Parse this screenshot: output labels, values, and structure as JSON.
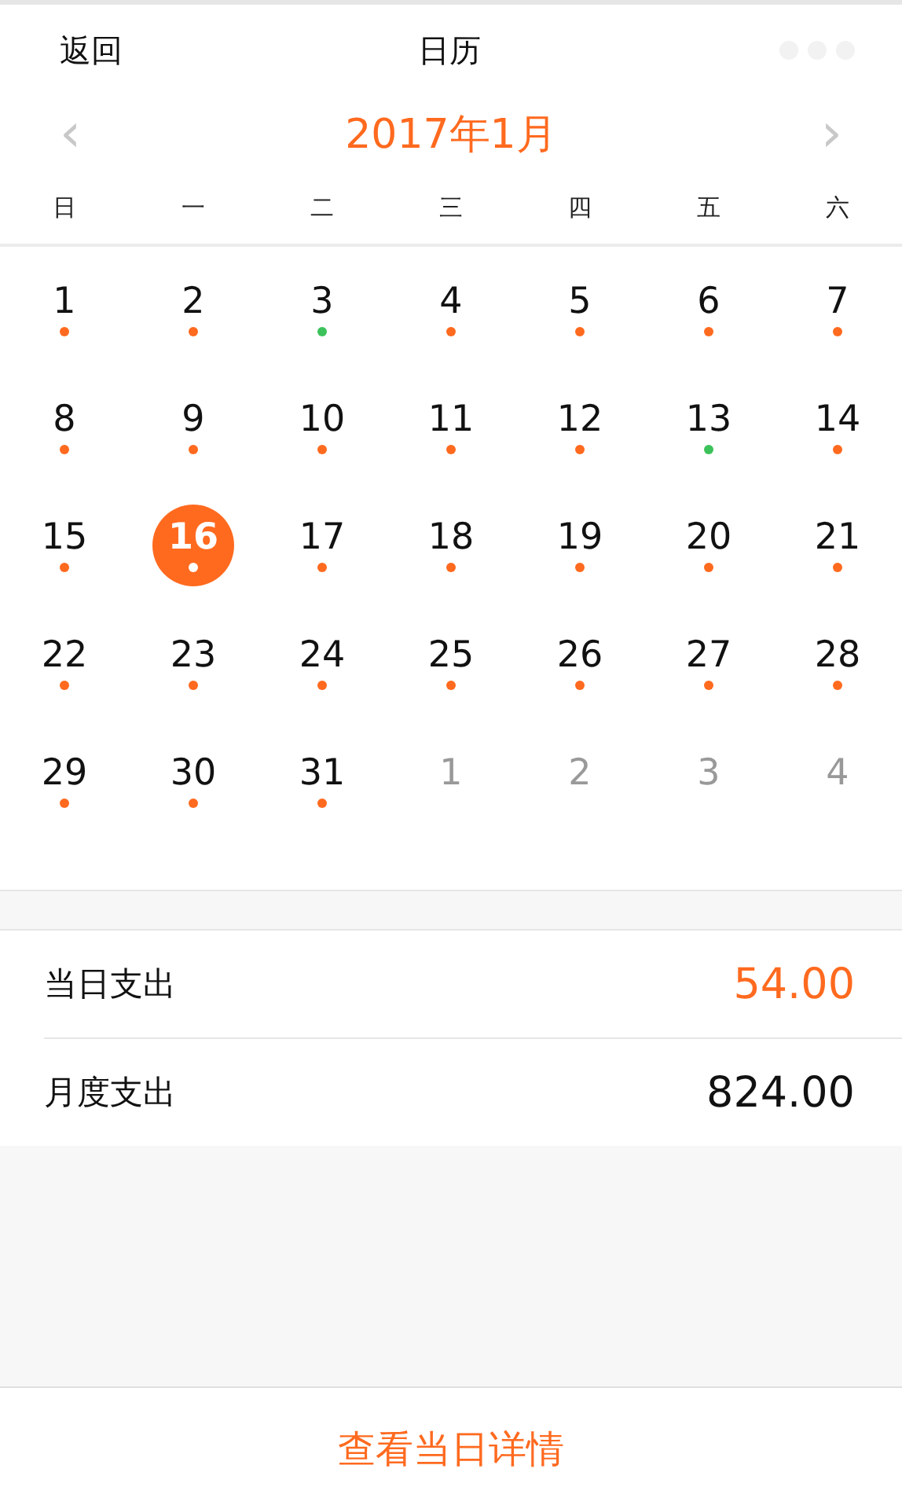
{
  "nav": {
    "back": "返回",
    "title": "日历"
  },
  "month": {
    "title": "2017年1月",
    "prev": "‹",
    "next": "›"
  },
  "weekdays": [
    "日",
    "一",
    "二",
    "三",
    "四",
    "五",
    "六"
  ],
  "days": [
    {
      "label": "1",
      "color": "#ff6a1f",
      "selected": false,
      "outside": false
    },
    {
      "label": "2",
      "color": "#ff6a1f",
      "selected": false,
      "outside": false
    },
    {
      "label": "3",
      "color": "#3cc25a",
      "selected": false,
      "outside": false
    },
    {
      "label": "4",
      "color": "#ff6a1f",
      "selected": false,
      "outside": false
    },
    {
      "label": "5",
      "color": "#ff6a1f",
      "selected": false,
      "outside": false
    },
    {
      "label": "6",
      "color": "#ff6a1f",
      "selected": false,
      "outside": false
    },
    {
      "label": "7",
      "color": "#ff6a1f",
      "selected": false,
      "outside": false
    },
    {
      "label": "8",
      "color": "#ff6a1f",
      "selected": false,
      "outside": false
    },
    {
      "label": "9",
      "color": "#ff6a1f",
      "selected": false,
      "outside": false
    },
    {
      "label": "10",
      "color": "#ff6a1f",
      "selected": false,
      "outside": false
    },
    {
      "label": "11",
      "color": "#ff6a1f",
      "selected": false,
      "outside": false
    },
    {
      "label": "12",
      "color": "#ff6a1f",
      "selected": false,
      "outside": false
    },
    {
      "label": "13",
      "color": "#3cc25a",
      "selected": false,
      "outside": false
    },
    {
      "label": "14",
      "color": "#ff6a1f",
      "selected": false,
      "outside": false
    },
    {
      "label": "15",
      "color": "#ff6a1f",
      "selected": false,
      "outside": false
    },
    {
      "label": "16",
      "color": "#ffffff",
      "selected": true,
      "outside": false
    },
    {
      "label": "17",
      "color": "#ff6a1f",
      "selected": false,
      "outside": false
    },
    {
      "label": "18",
      "color": "#ff6a1f",
      "selected": false,
      "outside": false
    },
    {
      "label": "19",
      "color": "#ff6a1f",
      "selected": false,
      "outside": false
    },
    {
      "label": "20",
      "color": "#ff6a1f",
      "selected": false,
      "outside": false
    },
    {
      "label": "21",
      "color": "#ff6a1f",
      "selected": false,
      "outside": false
    },
    {
      "label": "22",
      "color": "#ff6a1f",
      "selected": false,
      "outside": false
    },
    {
      "label": "23",
      "color": "#ff6a1f",
      "selected": false,
      "outside": false
    },
    {
      "label": "24",
      "color": "#ff6a1f",
      "selected": false,
      "outside": false
    },
    {
      "label": "25",
      "color": "#ff6a1f",
      "selected": false,
      "outside": false
    },
    {
      "label": "26",
      "color": "#ff6a1f",
      "selected": false,
      "outside": false
    },
    {
      "label": "27",
      "color": "#ff6a1f",
      "selected": false,
      "outside": false
    },
    {
      "label": "28",
      "color": "#ff6a1f",
      "selected": false,
      "outside": false
    },
    {
      "label": "29",
      "color": "#ff6a1f",
      "selected": false,
      "outside": false
    },
    {
      "label": "30",
      "color": "#ff6a1f",
      "selected": false,
      "outside": false
    },
    {
      "label": "31",
      "color": "#ff6a1f",
      "selected": false,
      "outside": false
    },
    {
      "label": "1",
      "selected": false,
      "outside": true
    },
    {
      "label": "2",
      "selected": false,
      "outside": true
    },
    {
      "label": "3",
      "selected": false,
      "outside": true
    },
    {
      "label": "4",
      "selected": false,
      "outside": true
    }
  ],
  "summary": [
    {
      "label": "当日支出",
      "value": "54.00",
      "kind": "highlight"
    },
    {
      "label": "月度支出",
      "value": "824.00",
      "kind": "plain"
    }
  ],
  "action": "查看当日详情"
}
